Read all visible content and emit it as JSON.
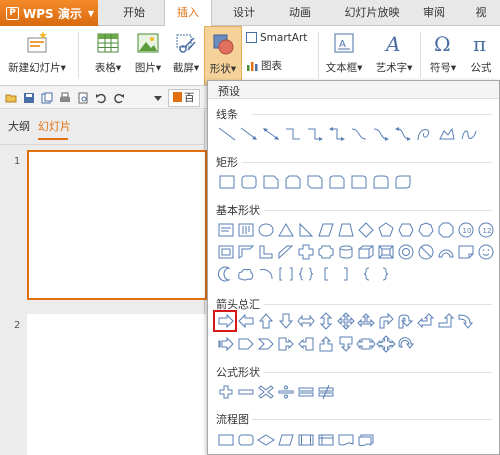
{
  "app": {
    "name": "WPS 演示",
    "logo": "P"
  },
  "tabs": [
    {
      "label": "开始",
      "active": false
    },
    {
      "label": "插入",
      "active": true
    },
    {
      "label": "设计",
      "active": false
    },
    {
      "label": "动画",
      "active": false
    },
    {
      "label": "幻灯片放映",
      "active": false
    },
    {
      "label": "审阅",
      "active": false
    },
    {
      "label": "视",
      "active": false
    }
  ],
  "ribbon": {
    "new_slide": "新建幻灯片",
    "table": "表格",
    "picture": "图片",
    "screenshot": "截屏",
    "shape": "形状",
    "smartart": "SmartArt",
    "chart": "图表",
    "textbox": "文本框",
    "wordart": "艺术字",
    "symbol": "符号",
    "formula": "公式",
    "dropdown_arrow": "▾"
  },
  "qat": {
    "doc_tab": "百"
  },
  "panel": {
    "outline_tab": "大纲",
    "slides_tab": "幻灯片",
    "slide_numbers": [
      "1",
      "2"
    ]
  },
  "dropdown": {
    "header": "预设",
    "categories": [
      "线条",
      "矩形",
      "基本形状",
      "箭头总汇",
      "公式形状",
      "流程图"
    ]
  },
  "colors": {
    "accent": "#e07010",
    "selection": "#d81818",
    "icon_blue": "#4a6fa5"
  }
}
